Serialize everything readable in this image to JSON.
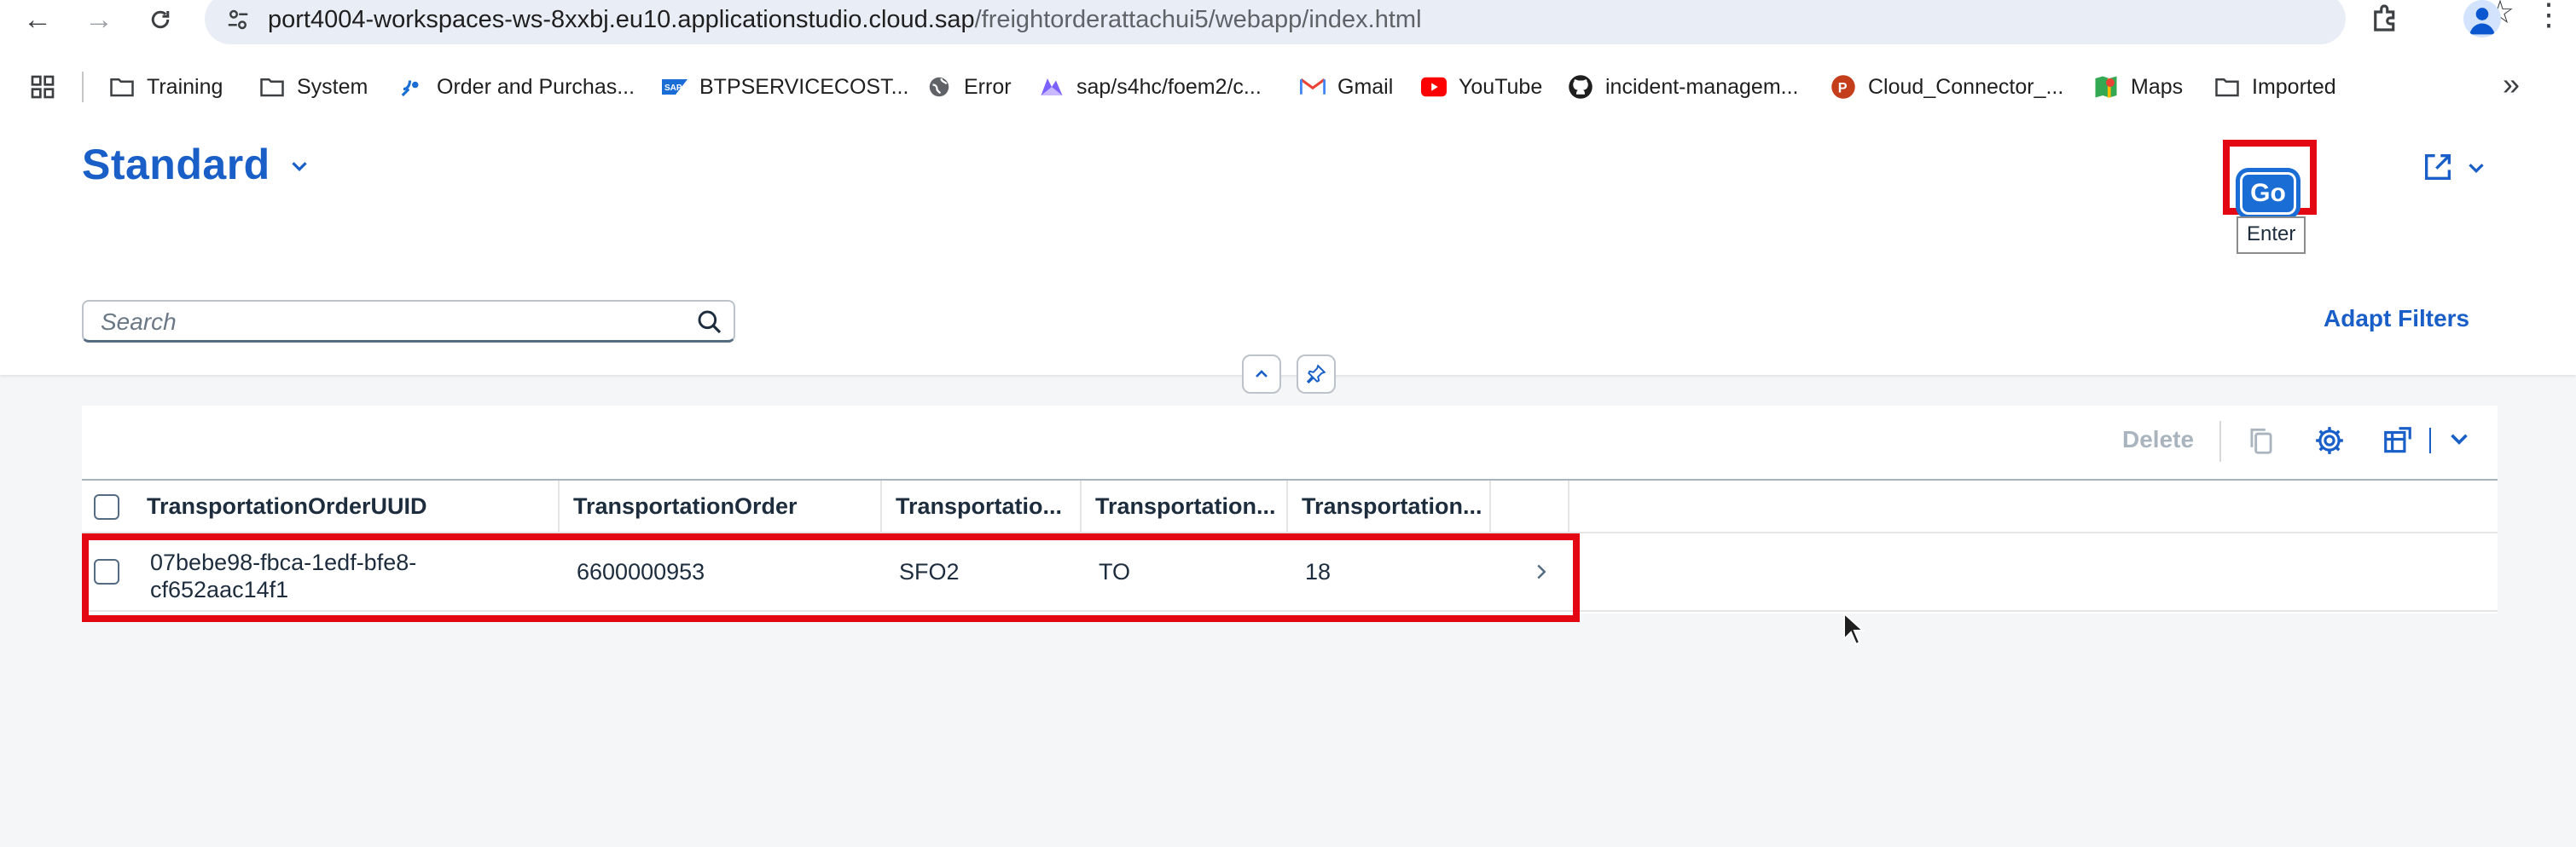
{
  "browser": {
    "url_host": "port4004-workspaces-ws-8xxbj.eu10.applicationstudio.cloud.sap",
    "url_path": "/freightorderattachui5/webapp/index.html",
    "bookmarks": [
      {
        "label": "Training",
        "icon": "folder-icon"
      },
      {
        "label": "System",
        "icon": "folder-icon"
      },
      {
        "label": "Order and Purchas...",
        "icon": "satellite-icon"
      },
      {
        "label": "BTPSERVICECOST...",
        "icon": "sap-logo-icon"
      },
      {
        "label": "Error",
        "icon": "globe-icon"
      },
      {
        "label": "sap/s4hc/foem2/c...",
        "icon": "gitlab-icon"
      },
      {
        "label": "Gmail",
        "icon": "gmail-icon"
      },
      {
        "label": "YouTube",
        "icon": "youtube-icon"
      },
      {
        "label": "incident-managem...",
        "icon": "github-icon"
      },
      {
        "label": "Cloud_Connector_...",
        "icon": "powerpoint-icon"
      },
      {
        "label": "Maps",
        "icon": "maps-icon"
      },
      {
        "label": "Imported",
        "icon": "folder-icon"
      }
    ]
  },
  "header": {
    "variant_title": "Standard",
    "search_placeholder": "Search",
    "go_label": "Go",
    "go_tooltip": "Enter",
    "adapt_filters_label": "Adapt Filters"
  },
  "table": {
    "delete_label": "Delete",
    "columns": [
      "TransportationOrderUUID",
      "TransportationOrder",
      "Transportatio...",
      "Transportation...",
      "Transportation..."
    ],
    "rows": [
      {
        "uuid": "07bebe98-fbca-1edf-bfe8-cf652aac14f1",
        "order": "6600000953",
        "col3": "SFO2",
        "col4": "TO",
        "col5": "18"
      }
    ]
  },
  "colors": {
    "accent": "#1a5fc8",
    "highlight": "#e30613",
    "background": "#f5f6f7"
  }
}
